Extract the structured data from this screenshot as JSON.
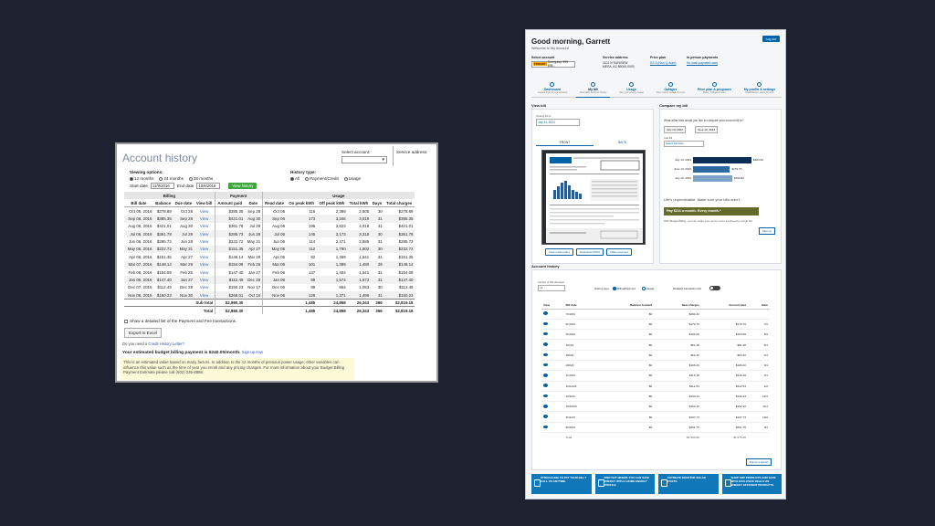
{
  "old": {
    "title": "Account history",
    "select_account_label": "Select account:",
    "service_address_label": "Service address:",
    "viewing_options_label": "Viewing options:",
    "radios": [
      "12 months",
      "24 months",
      "36 months"
    ],
    "start_label": "Start date",
    "start_value": "11/9/2016",
    "end_label": "End date",
    "end_value": "10/8/2016",
    "view_history": "View history",
    "history_type_label": "History type:",
    "history_radios": [
      "All",
      "Payment/Credit",
      "Usage"
    ],
    "groups": {
      "billing": "Billing",
      "payment": "Payment",
      "usage": "Usage"
    },
    "headers": [
      "Bill date",
      "Balance",
      "Due date",
      "View bill",
      "Amount paid",
      "Date",
      "Read date",
      "On peak kWh",
      "Off peak kWh",
      "Total kWh",
      "Days",
      "Total charges"
    ],
    "rows": [
      [
        "Oct 06, 2016",
        "$278.89",
        "Oct 28",
        "View",
        "$385.35",
        "Sep 28",
        "Oct 06",
        "116",
        "2,389",
        "2,505",
        "30",
        "$278.89"
      ],
      [
        "Sep 06, 2016",
        "$385.35",
        "Sep 28",
        "View",
        "$421.01",
        "Aug 30",
        "Sep 06",
        "173",
        "3,346",
        "3,519",
        "31",
        "$385.35"
      ],
      [
        "Aug 06, 2016",
        "$421.01",
        "Aug 30",
        "View",
        "$361.78",
        "Jul 28",
        "Aug 06",
        "195",
        "3,823",
        "4,018",
        "31",
        "$421.01"
      ],
      [
        "Jul 06, 2016",
        "$361.78",
        "Jul 28",
        "View",
        "$285.73",
        "Jun 28",
        "Jul 06",
        "145",
        "3,173",
        "3,318",
        "30",
        "$361.78"
      ],
      [
        "Jun 06, 2016",
        "$285.73",
        "Jun 28",
        "View",
        "$222.72",
        "May 31",
        "Jun 06",
        "114",
        "2,471",
        "2,585",
        "31",
        "$285.73"
      ],
      [
        "May 06, 2016",
        "$222.72",
        "May 31",
        "View",
        "$151.35",
        "Apr 27",
        "May 06",
        "112",
        "1,790",
        "1,902",
        "30",
        "$222.72"
      ],
      [
        "Apr 06, 2016",
        "$151.35",
        "Apr 27",
        "View",
        "$148.14",
        "Mar 29",
        "Apr 06",
        "82",
        "1,459",
        "1,541",
        "31",
        "$151.35"
      ],
      [
        "Mar 07, 2016",
        "$148.14",
        "Mar 29",
        "View",
        "$154.09",
        "Feb 26",
        "Mar 06",
        "101",
        "1,389",
        "1,490",
        "29",
        "$148.14"
      ],
      [
        "Feb 08, 2016",
        "$154.09",
        "Feb 26",
        "View",
        "$147.40",
        "Jan 27",
        "Feb 06",
        "137",
        "1,404",
        "1,541",
        "31",
        "$154.09"
      ],
      [
        "Jan 06, 2016",
        "$147.40",
        "Jan 27",
        "View",
        "$112.49",
        "Dec 28",
        "Jan 06",
        "99",
        "1,574",
        "1,673",
        "31",
        "$147.40"
      ],
      [
        "Dec 07, 2015",
        "$112.49",
        "Dec 28",
        "View",
        "$150.23",
        "Nov 17",
        "Dec 06",
        "99",
        "964",
        "1,053",
        "30",
        "$112.49"
      ],
      [
        "Nov 06, 2015",
        "$150.23",
        "Nov 30",
        "View",
        "$268.01",
        "Oct 16",
        "Nov 06",
        "128",
        "1,371",
        "1,499",
        "31",
        "$150.23"
      ]
    ],
    "subtotal": {
      "label": "Sub total",
      "amount": "$2,880.30",
      "on": "1,485",
      "off": "24,858",
      "total": "26,343",
      "days": "366",
      "charges": "$2,819.18"
    },
    "total": {
      "label": "Total",
      "amount": "$2,880.30",
      "on": "1,485",
      "off": "24,858",
      "total": "26,343",
      "days": "366",
      "charges": "$2,819.18"
    },
    "show_detailed": "Show a detailed list of the Payment and Fee transactions.",
    "export": "Export to Excel",
    "credit_q": "Do you need a",
    "credit_link": "Credit History Letter?",
    "budget_text": "Your estimated budget billing payment is $240.00/month.",
    "budget_link": "Sign up now",
    "note": "This is an estimated value based on many factors. In addition to the 12 months of previous power usage, other variables can influence this value such as the time of year you enroll and any pricing changes. For more information about your Budget Billing Payment Estimate please call (602) 236-8888."
  },
  "new": {
    "greeting": "Good morning, Garrett",
    "welcome": "Welcome to My Account",
    "logout": "Log out",
    "select_account": "Select account",
    "account_tag": "PRIMARY",
    "account_value": "Sunnyday, 999 898...",
    "service_address": "Service address",
    "address_l1": "1101 N SUNVIEW",
    "address_l2": "MESA, AZ 85000-0000",
    "price_plan": "Price plan",
    "price_link": "EZ-3 (Non Q-Aum)",
    "in_person": "In-person payments",
    "in_person_link": "No cash payment card",
    "tabs": [
      {
        "label": "Dashboard",
        "sub": "A quick look at your account"
      },
      {
        "label": "My bill",
        "sub": "View bills, account history"
      },
      {
        "label": "Usage",
        "sub": "See your energy usage"
      },
      {
        "label": "Outages",
        "sub": "View, report outage & more"
      },
      {
        "label": "Price plan & programs",
        "sub": "Plans, budget & more"
      },
      {
        "label": "My profile & settings",
        "sub": "Notifications, alerts & more"
      }
    ],
    "view_bill": {
      "title": "View bill",
      "viewing_label": "Viewing bill for",
      "viewing_value": "July 11, 2024",
      "front": "FRONT",
      "back": "BACK",
      "actions": [
        "View credit policy",
        "Download (PDF)",
        "Make payment"
      ]
    },
    "compare": {
      "title": "Compare my bill",
      "question": "What other bills would you like to compare your current bill to?",
      "chips": [
        "July 10, 2024",
        "June 10, 2024"
      ],
      "add_label": "Add bill",
      "add_dd": "Select bill date",
      "bars": [
        {
          "label": "July 10, 2024",
          "value": 284.32,
          "text": "$284.32",
          "color": "#0a2e55"
        },
        {
          "label": "June 10, 2024",
          "value": 179.79,
          "text": "$179.79",
          "color": "#2e6aa1"
        },
        {
          "label": "July 10, 2023",
          "value": 190.83,
          "text": "$190.83",
          "color": "#7ea3c9"
        }
      ],
      "life": "Life's unpredictable. Make sure your bills aren't.",
      "pay_button": "Pay $211 a month. Every month.*",
      "bb_text": "With Budget Billing, you can make sure you're never surprised by a high bill.",
      "sign_up": "Sign up"
    },
    "history": {
      "title": "Account history",
      "num_label": "Number of bills displayed",
      "num_value": "12",
      "history_type": "History type",
      "opt1": "Billing/Payment",
      "opt2": "Usage",
      "detailed": "Detailed transaction list",
      "headers": [
        "View",
        "Bill date",
        "Balance forward",
        "New charges",
        "Amount paid",
        "Date"
      ],
      "rows": [
        [
          "7/10/24",
          "$0",
          "$284.32",
          "",
          ""
        ],
        [
          "6/10/24",
          "$0",
          "$179.79",
          "$179.79",
          "7/2"
        ],
        [
          "5/10/24",
          "$0",
          "$104.06",
          "$104.06",
          "6/4"
        ],
        [
          "4/9/24",
          "$0",
          "$81.48",
          "$81.48",
          "5/1"
        ],
        [
          "3/8/24",
          "$0",
          "$64.32",
          "$64.32",
          "4/1"
        ],
        [
          "2/8/24",
          "$0",
          "$106.20",
          "$106.20",
          "3/1"
        ],
        [
          "1/10/24",
          "$0",
          "$116.18",
          "$116.18",
          "2/1"
        ],
        [
          "12/11/23",
          "$0",
          "$112.53",
          "$112.53",
          "1/2"
        ],
        [
          "11/9/23",
          "$0",
          "$130.44",
          "$130.44",
          "12/1"
        ],
        [
          "10/10/23",
          "$0",
          "$152.10",
          "$152.10",
          "11/1"
        ],
        [
          "9/11/23",
          "$0",
          "$197.73",
          "$197.73",
          "10/2"
        ],
        [
          "8/10/23",
          "$0",
          "$261.75",
          "$261.75",
          "9/1"
        ]
      ],
      "total_label": "Total",
      "total_new": "$1,590.68",
      "total_paid": "$1,575.36",
      "export": "Export to Excel"
    },
    "banners": [
      "STRUGGLING TO PAY YOUR BILL? CALL US ANYTIME.",
      "FIND OUT WHERE YOU CAN SAVE ENERGY WITH A HOME ENERGY PROFILE.",
      "ESTIMATE ROOFTOP SOLAR COSTS.",
      "SHOP SRP PRODUCTS AND SAVE WITH EXCLUSIVE DEALS ON ENERGY EFFICIENT PRODUCTS."
    ]
  }
}
